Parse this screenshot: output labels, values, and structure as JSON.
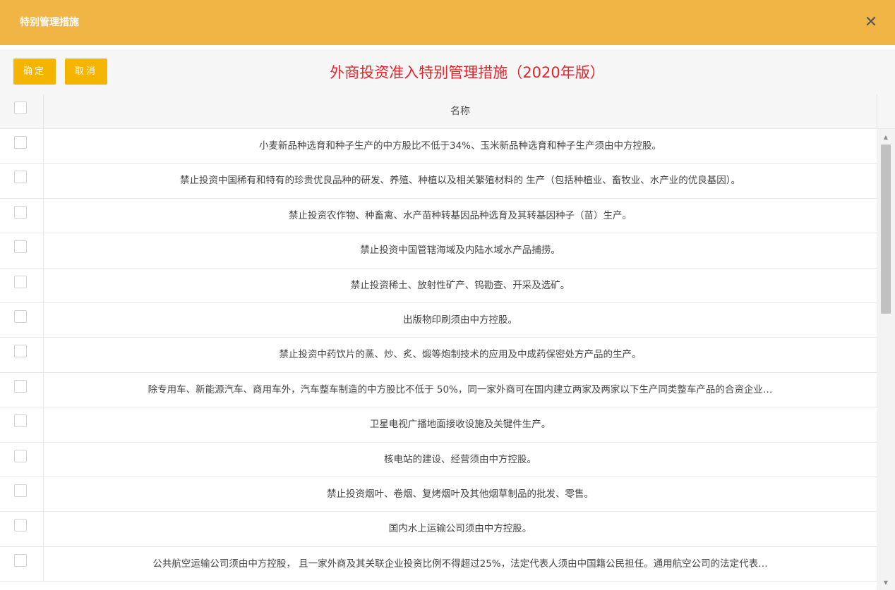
{
  "dialog": {
    "title": "特别管理措施",
    "close_glyph": "✕"
  },
  "toolbar": {
    "ok_label": "确定",
    "cancel_label": "取消",
    "heading": "外商投资准入特别管理措施（2020年版）"
  },
  "table": {
    "header": "名称",
    "rows": [
      "小麦新品种选育和种子生产的中方股比不低于34%、玉米新品种选育和种子生产须由中方控股。",
      "禁止投资中国稀有和特有的珍贵优良品种的研发、养殖、种植以及相关繁殖材料的 生产（包括种植业、畜牧业、水产业的优良基因）。",
      "禁止投资农作物、种畜禽、水产苗种转基因品种选育及其转基因种子（苗）生产。",
      "禁止投资中国管辖海域及内陆水域水产品捕捞。",
      "禁止投资稀土、放射性矿产、钨勘查、开采及选矿。",
      "出版物印刷须由中方控股。",
      "禁止投资中药饮片的蒸、炒、炙、煅等炮制技术的应用及中成药保密处方产品的生产。",
      "除专用车、新能源汽车、商用车外，汽车整车制造的中方股比不低于 50%，同一家外商可在国内建立两家及两家以下生产同类整车产品的合资企业…",
      "卫星电视广播地面接收设施及关键件生产。",
      "核电站的建设、经营须由中方控股。",
      "禁止投资烟叶、卷烟、复烤烟叶及其他烟草制品的批发、零售。",
      "国内水上运输公司须由中方控股。",
      "公共航空运输公司须由中方控股， 且一家外商及其关联企业投资比例不得超过25%，法定代表人须由中国籍公民担任。通用航空公司的法定代表…"
    ]
  },
  "scrollbar": {
    "up_glyph": "▲",
    "down_glyph": "▼"
  },
  "colors": {
    "titlebar": "#f0b545",
    "button": "#f5b400",
    "heading": "#e5252c"
  }
}
